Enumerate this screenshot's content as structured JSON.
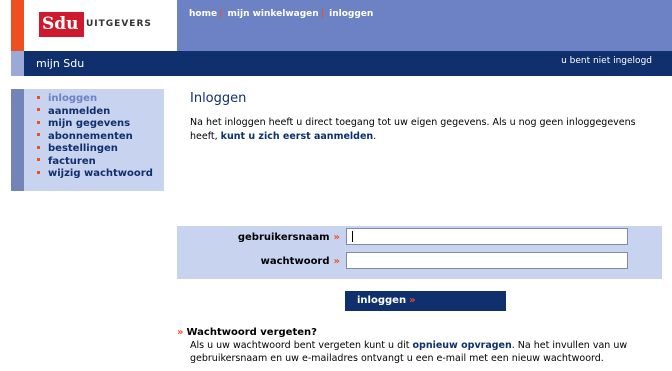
{
  "brand": {
    "logo_text": "Sdu",
    "logo_word": "UITGEVERS",
    "section": "mijn Sdu"
  },
  "topnav": {
    "home": "home",
    "cart": "mijn winkelwagen",
    "login": "inloggen",
    "separator": "|"
  },
  "status": "u bent niet ingelogd",
  "sidebar": {
    "items": [
      {
        "label": "inloggen",
        "active": true
      },
      {
        "label": "aanmelden"
      },
      {
        "label": "mijn gegevens"
      },
      {
        "label": "abonnementen"
      },
      {
        "label": "bestellingen"
      },
      {
        "label": "facturen"
      },
      {
        "label": "wijzig wachtwoord"
      }
    ]
  },
  "main": {
    "title": "Inloggen",
    "intro_before": "Na het inloggen heeft u direct toegang tot uw eigen gegevens. Als u nog geen inloggegevens heeft, ",
    "intro_link": "kunt u zich eerst aanmelden",
    "intro_after": "."
  },
  "form": {
    "username_label": "gebruikersnaam",
    "password_label": "wachtwoord",
    "username_value": "",
    "password_value": "",
    "arrow": "»",
    "submit_label": "inloggen"
  },
  "forgot": {
    "title": "Wachtwoord vergeten?",
    "text_before": "Als u uw wachtwoord bent vergeten kunt u dit ",
    "link": "opnieuw opvragen",
    "text_after": ". Na het invullen van uw gebruikersnaam en uw e-mailadres ontvangt u een e-mail met een nieuw wachtwoord."
  },
  "colors": {
    "navy": "#0f2f6d",
    "header_blue": "#6c82c5",
    "panel": "#c8d3ef",
    "accent": "#ef4e1f",
    "logo_red": "#cf1a2d"
  }
}
